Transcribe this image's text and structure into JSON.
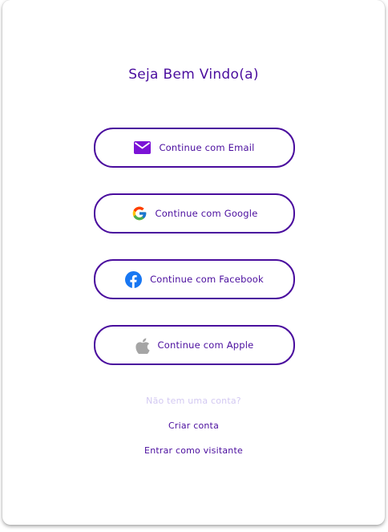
{
  "welcome": {
    "title": "Seja Bem Vindo(a)"
  },
  "login_options": {
    "email": {
      "label": "Continue com Email",
      "icon": "envelope-icon",
      "icon_color": "#7b12d6"
    },
    "google": {
      "label": "Continue com Google",
      "icon": "google-icon"
    },
    "facebook": {
      "label": "Continue com Facebook",
      "icon": "facebook-icon",
      "icon_color": "#1877f2"
    },
    "apple": {
      "label": "Continue com Apple",
      "icon": "apple-icon",
      "icon_color": "#a5a5a5"
    }
  },
  "footer": {
    "no_account_text": "Não tem uma conta?",
    "create_account_label": "Criar conta",
    "guest_label": "Entrar como visitante"
  },
  "colors": {
    "accent": "#4a0d9e",
    "muted": "#d3c9f2",
    "background": "#ffffff"
  }
}
